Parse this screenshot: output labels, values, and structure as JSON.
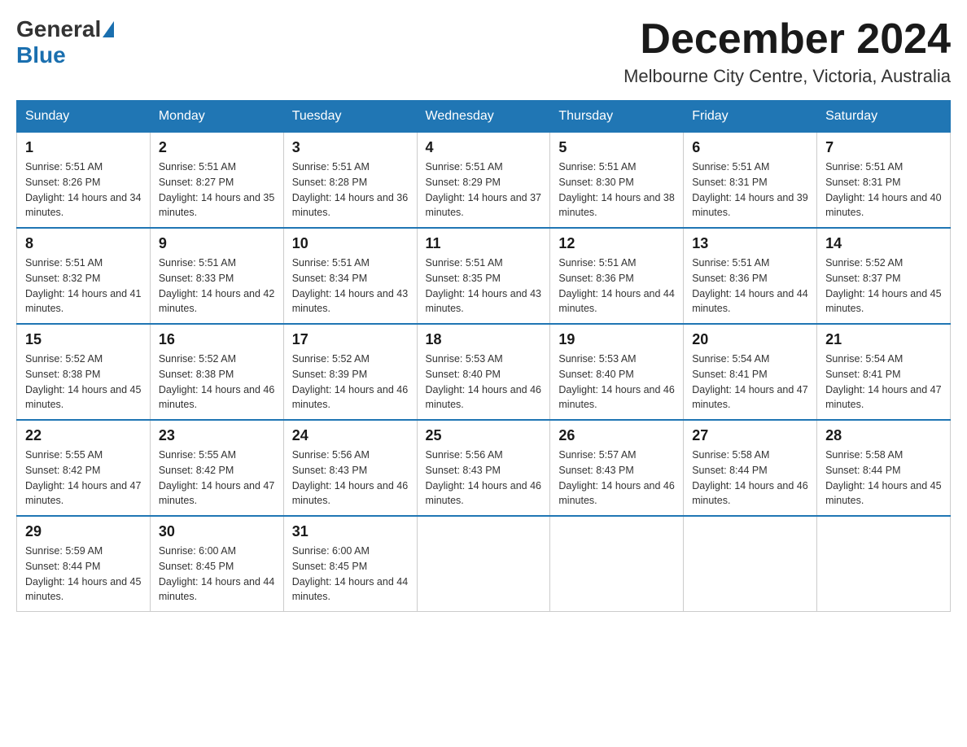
{
  "header": {
    "logo_general": "General",
    "logo_blue": "Blue",
    "month_title": "December 2024",
    "location": "Melbourne City Centre, Victoria, Australia"
  },
  "calendar": {
    "days_of_week": [
      "Sunday",
      "Monday",
      "Tuesday",
      "Wednesday",
      "Thursday",
      "Friday",
      "Saturday"
    ],
    "weeks": [
      [
        {
          "day": "1",
          "sunrise": "5:51 AM",
          "sunset": "8:26 PM",
          "daylight": "14 hours and 34 minutes."
        },
        {
          "day": "2",
          "sunrise": "5:51 AM",
          "sunset": "8:27 PM",
          "daylight": "14 hours and 35 minutes."
        },
        {
          "day": "3",
          "sunrise": "5:51 AM",
          "sunset": "8:28 PM",
          "daylight": "14 hours and 36 minutes."
        },
        {
          "day": "4",
          "sunrise": "5:51 AM",
          "sunset": "8:29 PM",
          "daylight": "14 hours and 37 minutes."
        },
        {
          "day": "5",
          "sunrise": "5:51 AM",
          "sunset": "8:30 PM",
          "daylight": "14 hours and 38 minutes."
        },
        {
          "day": "6",
          "sunrise": "5:51 AM",
          "sunset": "8:31 PM",
          "daylight": "14 hours and 39 minutes."
        },
        {
          "day": "7",
          "sunrise": "5:51 AM",
          "sunset": "8:31 PM",
          "daylight": "14 hours and 40 minutes."
        }
      ],
      [
        {
          "day": "8",
          "sunrise": "5:51 AM",
          "sunset": "8:32 PM",
          "daylight": "14 hours and 41 minutes."
        },
        {
          "day": "9",
          "sunrise": "5:51 AM",
          "sunset": "8:33 PM",
          "daylight": "14 hours and 42 minutes."
        },
        {
          "day": "10",
          "sunrise": "5:51 AM",
          "sunset": "8:34 PM",
          "daylight": "14 hours and 43 minutes."
        },
        {
          "day": "11",
          "sunrise": "5:51 AM",
          "sunset": "8:35 PM",
          "daylight": "14 hours and 43 minutes."
        },
        {
          "day": "12",
          "sunrise": "5:51 AM",
          "sunset": "8:36 PM",
          "daylight": "14 hours and 44 minutes."
        },
        {
          "day": "13",
          "sunrise": "5:51 AM",
          "sunset": "8:36 PM",
          "daylight": "14 hours and 44 minutes."
        },
        {
          "day": "14",
          "sunrise": "5:52 AM",
          "sunset": "8:37 PM",
          "daylight": "14 hours and 45 minutes."
        }
      ],
      [
        {
          "day": "15",
          "sunrise": "5:52 AM",
          "sunset": "8:38 PM",
          "daylight": "14 hours and 45 minutes."
        },
        {
          "day": "16",
          "sunrise": "5:52 AM",
          "sunset": "8:38 PM",
          "daylight": "14 hours and 46 minutes."
        },
        {
          "day": "17",
          "sunrise": "5:52 AM",
          "sunset": "8:39 PM",
          "daylight": "14 hours and 46 minutes."
        },
        {
          "day": "18",
          "sunrise": "5:53 AM",
          "sunset": "8:40 PM",
          "daylight": "14 hours and 46 minutes."
        },
        {
          "day": "19",
          "sunrise": "5:53 AM",
          "sunset": "8:40 PM",
          "daylight": "14 hours and 46 minutes."
        },
        {
          "day": "20",
          "sunrise": "5:54 AM",
          "sunset": "8:41 PM",
          "daylight": "14 hours and 47 minutes."
        },
        {
          "day": "21",
          "sunrise": "5:54 AM",
          "sunset": "8:41 PM",
          "daylight": "14 hours and 47 minutes."
        }
      ],
      [
        {
          "day": "22",
          "sunrise": "5:55 AM",
          "sunset": "8:42 PM",
          "daylight": "14 hours and 47 minutes."
        },
        {
          "day": "23",
          "sunrise": "5:55 AM",
          "sunset": "8:42 PM",
          "daylight": "14 hours and 47 minutes."
        },
        {
          "day": "24",
          "sunrise": "5:56 AM",
          "sunset": "8:43 PM",
          "daylight": "14 hours and 46 minutes."
        },
        {
          "day": "25",
          "sunrise": "5:56 AM",
          "sunset": "8:43 PM",
          "daylight": "14 hours and 46 minutes."
        },
        {
          "day": "26",
          "sunrise": "5:57 AM",
          "sunset": "8:43 PM",
          "daylight": "14 hours and 46 minutes."
        },
        {
          "day": "27",
          "sunrise": "5:58 AM",
          "sunset": "8:44 PM",
          "daylight": "14 hours and 46 minutes."
        },
        {
          "day": "28",
          "sunrise": "5:58 AM",
          "sunset": "8:44 PM",
          "daylight": "14 hours and 45 minutes."
        }
      ],
      [
        {
          "day": "29",
          "sunrise": "5:59 AM",
          "sunset": "8:44 PM",
          "daylight": "14 hours and 45 minutes."
        },
        {
          "day": "30",
          "sunrise": "6:00 AM",
          "sunset": "8:45 PM",
          "daylight": "14 hours and 44 minutes."
        },
        {
          "day": "31",
          "sunrise": "6:00 AM",
          "sunset": "8:45 PM",
          "daylight": "14 hours and 44 minutes."
        },
        null,
        null,
        null,
        null
      ]
    ]
  }
}
